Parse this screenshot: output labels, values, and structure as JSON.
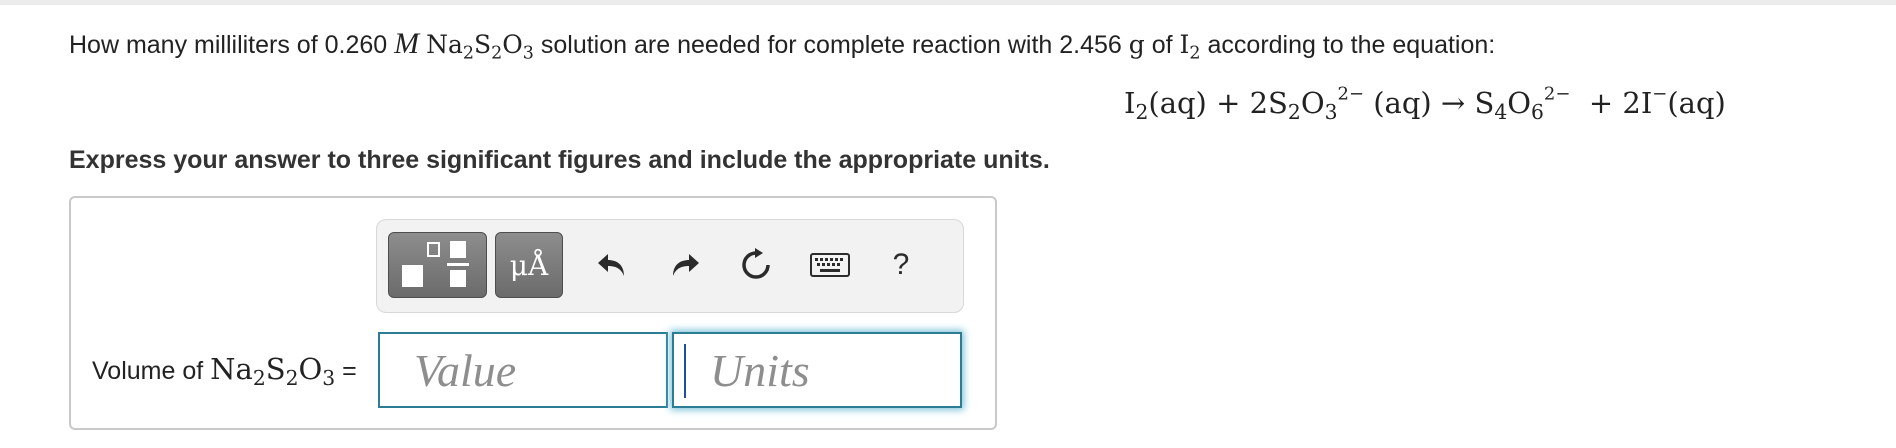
{
  "question": {
    "prefix": "How many milliliters of 0.260",
    "unit_m": "M",
    "reagent": {
      "na": "Na",
      "na_sub": "2",
      "s": "S",
      "s_sub": "2",
      "o": "O",
      "o_sub": "3"
    },
    "middle": "solution are needed for complete reaction with 2.456",
    "grams_unit": "g",
    "of_text": "of",
    "iodine": {
      "i": "I",
      "i_sub": "2"
    },
    "suffix": "according to the equation:"
  },
  "equation": {
    "t1": "I",
    "t1_sub": "2",
    "t1_state": "(aq) + 2S",
    "t2_sub": "2",
    "t2_o": "O",
    "t2_o_sub": "3",
    "t2_charge": "2−",
    "t2_state": "(aq) → S",
    "t3_sub": "4",
    "t3_o": "O",
    "t3_o_sub": "6",
    "t3_charge": "2−",
    "t3_plus": "+ 2I",
    "t4_charge": "−",
    "t4_state": "(aq)"
  },
  "instruction": "Express your answer to three significant figures and include the appropriate units.",
  "toolbar": {
    "units_label": "μÅ",
    "help_label": "?",
    "icons": [
      "templates-icon",
      "units-icon",
      "undo-icon",
      "redo-icon",
      "reset-icon",
      "keyboard-icon",
      "help-icon"
    ]
  },
  "answer": {
    "label_prefix": "Volume of",
    "label_formula": {
      "na": "Na",
      "na_sub": "2",
      "s": "S",
      "s_sub": "2",
      "o": "O",
      "o_sub": "3"
    },
    "equals": "=",
    "value_placeholder": "Value",
    "units_placeholder": "Units"
  },
  "colors": {
    "input_border": "#2b7d93",
    "focus_glow": "#7fc4da",
    "toolbar_button": "#7a7a7a"
  }
}
